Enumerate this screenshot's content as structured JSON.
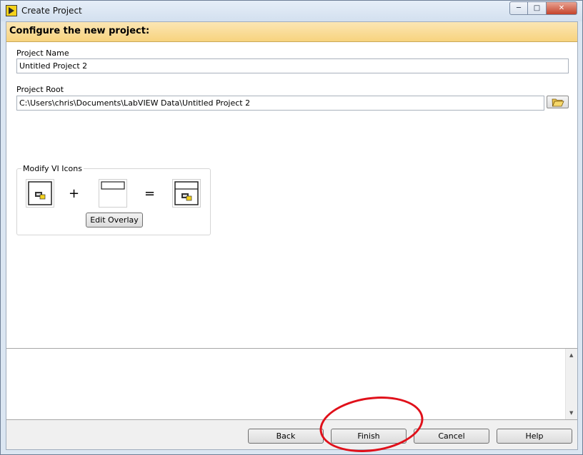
{
  "window": {
    "title": "Create Project",
    "icon": "labview-icon",
    "controls": [
      "minimize-icon",
      "maximize-icon",
      "close-icon"
    ]
  },
  "banner": {
    "text": "Configure the new project:"
  },
  "form": {
    "project_name_label": "Project Name",
    "project_name_value": "Untitled Project 2",
    "project_root_label": "Project Root",
    "project_root_value": "C:\\Users\\chris\\Documents\\LabVIEW Data\\Untitled Project 2",
    "browse_icon": "folder-open-icon"
  },
  "modify_icons": {
    "title": "Modify VI Icons",
    "plus": "+",
    "equals": "=",
    "edit_overlay_label": "Edit Overlay"
  },
  "footer": {
    "back_label": "Back",
    "finish_label": "Finish",
    "cancel_label": "Cancel",
    "help_label": "Help"
  },
  "annotation_color": "#e0101a"
}
